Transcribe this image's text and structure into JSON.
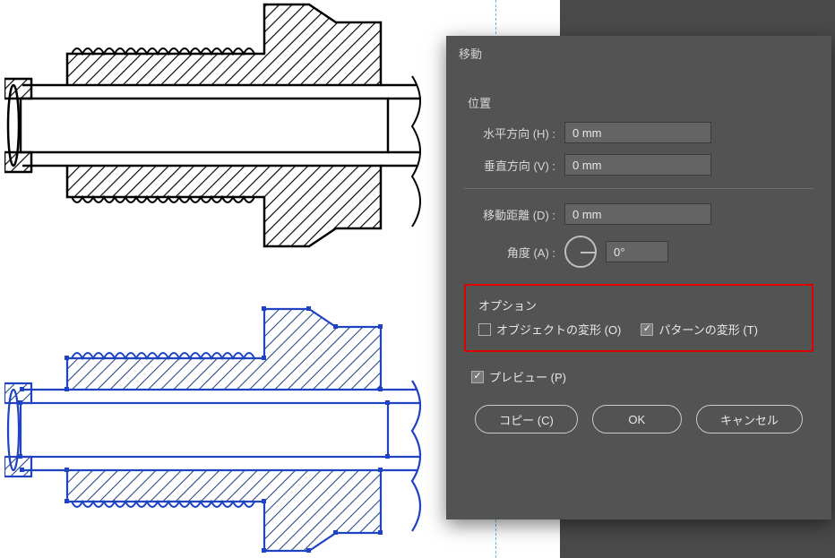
{
  "dialog": {
    "title": "移動",
    "position_section": "位置",
    "horizontal_label": "水平方向 (H) :",
    "horizontal_value": "0 mm",
    "vertical_label": "垂直方向 (V) :",
    "vertical_value": "0 mm",
    "distance_label": "移動距離 (D) :",
    "distance_value": "0 mm",
    "angle_label": "角度 (A) :",
    "angle_value": "0°",
    "options_section": "オプション",
    "transform_objects_label": "オブジェクトの変形 (O)",
    "transform_objects_checked": false,
    "transform_patterns_label": "パターンの変形 (T)",
    "transform_patterns_checked": true,
    "preview_label": "プレビュー (P)",
    "preview_checked": true,
    "copy_button": "コピー (C)",
    "ok_button": "OK",
    "cancel_button": "キャンセル"
  }
}
